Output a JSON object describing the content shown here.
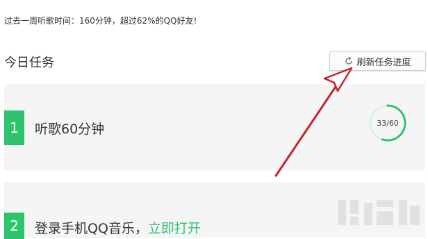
{
  "summary": "过去一周听歌时间：160分钟，超过62%的QQ好友!",
  "section_title": "今日任务",
  "refresh_button": {
    "label": "刷新任务进度",
    "icon": "refresh-icon"
  },
  "tasks": [
    {
      "number": "1",
      "text": "听歌60分钟",
      "progress_label": "33/60",
      "progress_value": 33,
      "progress_max": 60
    },
    {
      "number": "2",
      "text": "登录手机QQ音乐，",
      "link": "立即打开"
    }
  ],
  "colors": {
    "accent": "#2ec46e",
    "card_bg": "#f5f5f5",
    "arrow": "#c8232c",
    "ring_track": "#d7f2e2"
  }
}
